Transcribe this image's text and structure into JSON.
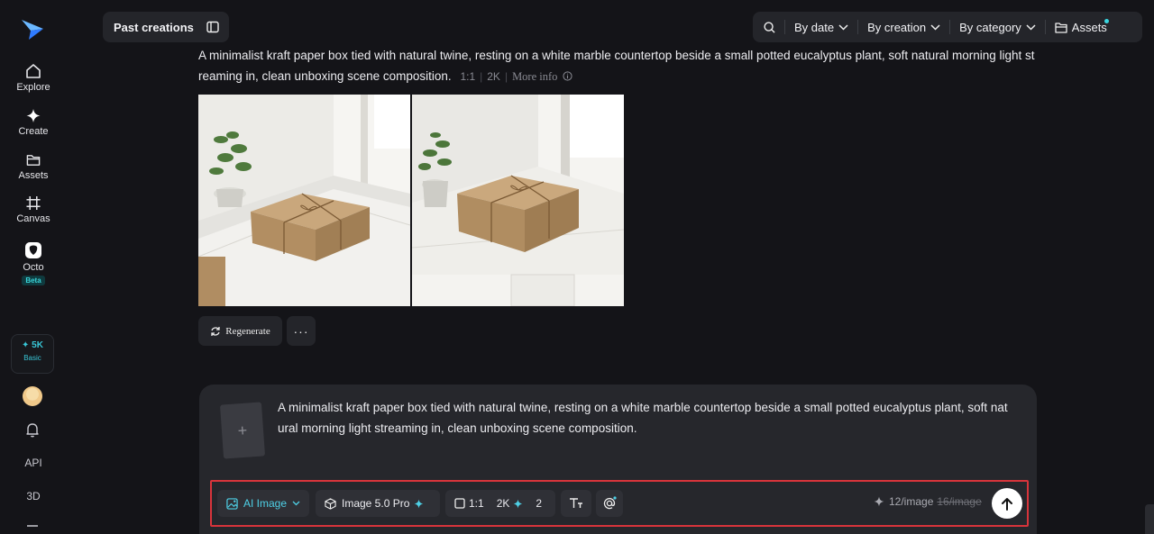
{
  "sidebar": {
    "items": [
      {
        "label": "Explore",
        "icon": "home-icon"
      },
      {
        "label": "Create",
        "icon": "sparkle-icon"
      },
      {
        "label": "Assets",
        "icon": "folder-icon"
      },
      {
        "label": "Canvas",
        "icon": "canvas-icon"
      },
      {
        "label": "Octo",
        "icon": "octo-icon",
        "badge": "Beta"
      }
    ],
    "credits": {
      "amount": "✦ 5K",
      "plan": "Basic"
    },
    "api_label": "API",
    "three_d_label": "3D"
  },
  "header": {
    "past_creations": "Past creations",
    "filters": {
      "by_date": "By date",
      "by_creation": "By creation",
      "by_category": "By category",
      "assets": "Assets"
    }
  },
  "creation": {
    "prompt": "A minimalist kraft paper box tied with natural twine, resting on a white marble countertop beside a small potted eucalyptus plant, soft natural morning light st reaming in, clean unboxing scene composition.",
    "ratio": "1:1",
    "resolution": "2K",
    "more_info": "More info",
    "regenerate_label": "Regenerate",
    "more_label": "···"
  },
  "composer": {
    "prompt": "A minimalist kraft paper box tied with natural twine, resting on a white marble countertop beside a small potted eucalyptus plant, soft nat ural morning light streaming in, clean unboxing scene composition.",
    "mode": "AI Image",
    "model": "Image 5.0 Pro",
    "ratio": "1:1",
    "resolution": "2K",
    "count": "2",
    "price": "12/image",
    "price_original": "16/image"
  },
  "colors": {
    "accent": "#3ad6e0",
    "highlight_border": "#d8343b",
    "background": "#141418"
  }
}
